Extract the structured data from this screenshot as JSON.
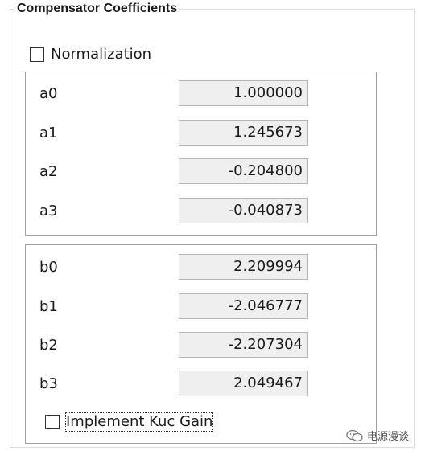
{
  "panel": {
    "title": "Compensator Coefficients"
  },
  "normalization": {
    "label": "Normalization",
    "checked": false
  },
  "a_coefficients": [
    {
      "label": "a0",
      "value": "1.000000"
    },
    {
      "label": "a1",
      "value": "1.245673"
    },
    {
      "label": "a2",
      "value": "-0.204800"
    },
    {
      "label": "a3",
      "value": "-0.040873"
    }
  ],
  "b_coefficients": [
    {
      "label": "b0",
      "value": "2.209994"
    },
    {
      "label": "b1",
      "value": "-2.046777"
    },
    {
      "label": "b2",
      "value": "-2.207304"
    },
    {
      "label": "b3",
      "value": "2.049467"
    }
  ],
  "kuc_gain": {
    "label": "Implement Kuc Gain",
    "checked": false
  },
  "watermark": {
    "text": "电源漫谈",
    "icon": "wechat-icon"
  }
}
